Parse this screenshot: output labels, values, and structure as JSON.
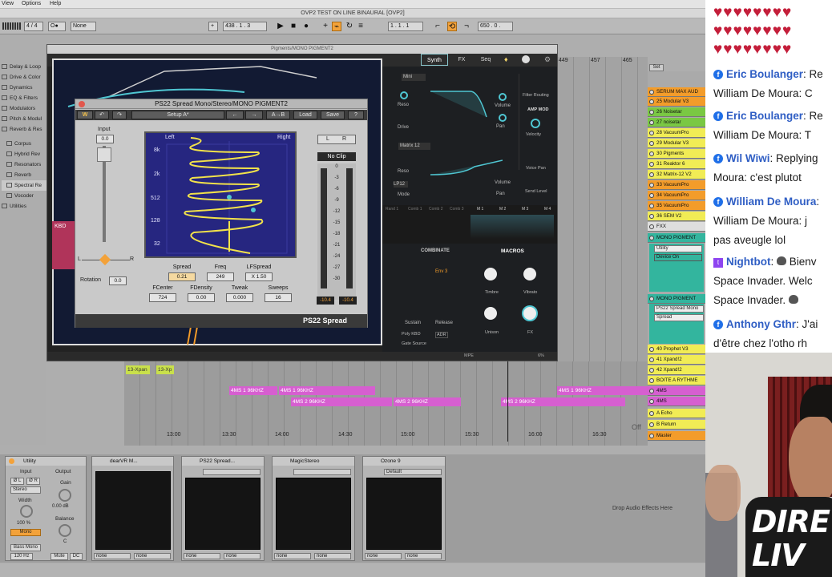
{
  "menubar": {
    "items": [
      "View",
      "Options",
      "Help"
    ]
  },
  "ableton": {
    "title": "OVP2 TEST ON LINE BINAURAL  [OVP2]",
    "transport": {
      "signature": "4 / 4",
      "quant": "None",
      "position": "438 . 1 . 3",
      "loop_start": "1 . 1 . 1",
      "loop_length": "650 . 0 ."
    },
    "browser": {
      "items": [
        "Delay & Loop",
        "Drive & Color",
        "Dynamics",
        "EQ & Filters",
        "Modulators",
        "Pitch & Modul",
        "Reverb & Res",
        "Corpus",
        "Hybrid Rev",
        "Resonators",
        "Reverb",
        "Spectral Re",
        "Vocoder",
        "Utilities"
      ]
    },
    "arrange_ruler": [
      "449",
      "457",
      "465"
    ],
    "set_label": "Set",
    "timeline": [
      "13:00",
      "13:30",
      "14:00",
      "14:30",
      "15:00",
      "15:30",
      "16:00",
      "16:30"
    ],
    "off_label": "Off",
    "drop_hint": "Drop Audio Effects Here",
    "clips": {
      "xpan": "13-Xpan",
      "xpan2": "13-Xp",
      "ms96": "4MS 1 96KHZ",
      "ms296": "4MS 2 96KHZ"
    }
  },
  "pigments": {
    "window_title": "Pigments/MONO PIGMENT2",
    "tabs": [
      "Synth",
      "FX",
      "Seq"
    ],
    "panel": {
      "filter1": "Mini",
      "filter2": "Matrix 12",
      "lp": "LP12",
      "knobs": [
        "Reso",
        "Drive",
        "Volume",
        "Pan",
        "Reso",
        "Mode",
        "Volume",
        "Pan"
      ],
      "routing": "Filter Routing",
      "amp_mod": "AMP MOD",
      "velocity": "Velocity",
      "voice_pan": "Voice Pan",
      "send_level": "Send Level",
      "seq_tabs": [
        "Rand 1",
        "Comb 1",
        "Comb 2",
        "Comb 3",
        "M 1",
        "M 2",
        "M 3",
        "M 4"
      ],
      "combinate": "COMBINATE",
      "macros": "MACROS",
      "env": "Env 3",
      "sustain": "Sustain",
      "release": "Release",
      "poly": "Poly KBD",
      "adr": "ADR",
      "gate": "Gate Source",
      "macro_labels": [
        "Timbre",
        "Vibrato",
        "Unison",
        "FX"
      ],
      "kbd": "KBD",
      "mpe": "MPE",
      "pct": "6%"
    }
  },
  "ps22": {
    "title": "PS22 Spread Mono/Stereo/MONO PIGMENT2",
    "toolbar": {
      "setup": "Setup A*",
      "ab": "A→B",
      "load": "Load",
      "save": "Save",
      "help": "?"
    },
    "input_label": "Input",
    "input_value": "0.0",
    "rotation_label": "Rotation",
    "rotation_value": "0.0",
    "lr": [
      "L",
      "R"
    ],
    "display_left": "Left",
    "display_right": "Right",
    "freq_labels": [
      "8k",
      "2k",
      "512",
      "128",
      "32"
    ],
    "noclip": "No Clip",
    "meter_scale": [
      "0",
      "-3",
      "-6",
      "-9",
      "-12",
      "-15",
      "-18",
      "-21",
      "-24",
      "-27",
      "-30"
    ],
    "meter_values": [
      "-10.4",
      "-10.4"
    ],
    "params": [
      {
        "label": "Spread",
        "value": "0.21"
      },
      {
        "label": "Freq",
        "value": "249"
      },
      {
        "label": "LFSpread",
        "value": "X 1.50"
      },
      {
        "label": "FCenter",
        "value": "724"
      },
      {
        "label": "FDensity",
        "value": "0.00"
      },
      {
        "label": "Tweak",
        "value": "0.000"
      },
      {
        "label": "Sweeps",
        "value": "16"
      }
    ],
    "brand": "PS22 Spread"
  },
  "tracks": [
    {
      "name": "SERUM MAX AUD",
      "c": "o"
    },
    {
      "name": "25 Modular V3",
      "c": "o"
    },
    {
      "name": "26 Noisetar",
      "c": "g"
    },
    {
      "name": "27 noisetar",
      "c": "g"
    },
    {
      "name": "28 VacuumPro",
      "c": "y"
    },
    {
      "name": "29 Modular V3",
      "c": "y"
    },
    {
      "name": "30 Pigments",
      "c": "y"
    },
    {
      "name": "31 Reaktor 6",
      "c": "y"
    },
    {
      "name": "32 Matrix-12 V2",
      "c": "y"
    },
    {
      "name": "33 VacuumPro",
      "c": "o"
    },
    {
      "name": "34 VacuumPro",
      "c": "o"
    },
    {
      "name": "35 VacuumPro",
      "c": "o"
    },
    {
      "name": "36 SEM V2",
      "c": "y"
    },
    {
      "name": "FXX",
      "c": "w"
    },
    {
      "name": "MONO PIGMENT",
      "c": "t"
    }
  ],
  "tracks_mid": {
    "utility": "Utility",
    "device_on": "Device On",
    "mono2": "MONO PIGMENT",
    "ps22": "PS22 Spread Mono",
    "spread": "Spread"
  },
  "tracks_low": [
    {
      "name": "40 Prophet V3",
      "c": "y"
    },
    {
      "name": "41 Xpand!2",
      "c": "y"
    },
    {
      "name": "42 Xpand!2",
      "c": "y"
    },
    {
      "name": "BOITE A RYTHME",
      "c": "y"
    },
    {
      "name": "4MS",
      "c": "p"
    },
    {
      "name": "4MS",
      "c": "p"
    },
    {
      "name": "A Echo",
      "c": "y"
    },
    {
      "name": "B Return",
      "c": "y"
    },
    {
      "name": "Master",
      "c": "o"
    }
  ],
  "devices": {
    "utility": {
      "title": "Utility",
      "input": "Input",
      "output": "Output",
      "phase": [
        "Ø L",
        "Ø R"
      ],
      "mode": "Stereo",
      "width_label": "Width",
      "width": "100 %",
      "mono": "Mono",
      "gain_label": "Gain",
      "gain": "0.00 dB",
      "balance_label": "Balance",
      "balance": "C",
      "bass_mono": "Bass Mono",
      "hz": "120 Hz",
      "mute": "Mute",
      "dc": "DC"
    },
    "chain": [
      {
        "title": "dearVR M...",
        "sel": "",
        "none": [
          "none",
          "none"
        ]
      },
      {
        "title": "PS22 Spread...",
        "sel": "",
        "none": [
          "none",
          "none"
        ]
      },
      {
        "title": "MagicStereo",
        "sel": "",
        "none": [
          "none",
          "none"
        ]
      },
      {
        "title": "Ozone 9",
        "sel": "Default",
        "none": [
          "none",
          "none"
        ]
      }
    ]
  },
  "chat": {
    "messages": [
      {
        "icon": "facebook",
        "user": "Eric Boulanger",
        "sep": ":",
        "rest": " Re",
        "line2": "William De Moura: C"
      },
      {
        "icon": "facebook",
        "user": "Eric Boulanger",
        "sep": ":",
        "rest": " Re",
        "line2": "William De Moura: T"
      },
      {
        "icon": "facebook",
        "user": "Wil Wiwi",
        "sep": ":",
        "rest": " Replying",
        "line2": "Moura: c'est plutot"
      },
      {
        "icon": "facebook",
        "user": "William De Moura",
        "sep": ":",
        "rest": "",
        "line2": "William De Moura: j",
        "line3": "pas aveugle lol"
      },
      {
        "icon": "twitch",
        "user": "Nightbot",
        "sep": ":",
        "rest": " Bienv",
        "line2": "Space Invader. Welc",
        "line3": "Space Invader."
      },
      {
        "icon": "facebook",
        "user": "Anthony Gthr",
        "sep": ":",
        "rest": " J'ai",
        "line2": "d'être chez l'otho rh"
      }
    ]
  },
  "overlay": {
    "line1": "DIRE",
    "line2": "LIV"
  },
  "colors": {
    "accent": "#f3a23a",
    "ps22_display": "#262680",
    "pigments_teal": "#4fc6d2",
    "clip": "#d65fd0",
    "chat_user": "#2f5ec4",
    "heart": "#c41e3a"
  }
}
